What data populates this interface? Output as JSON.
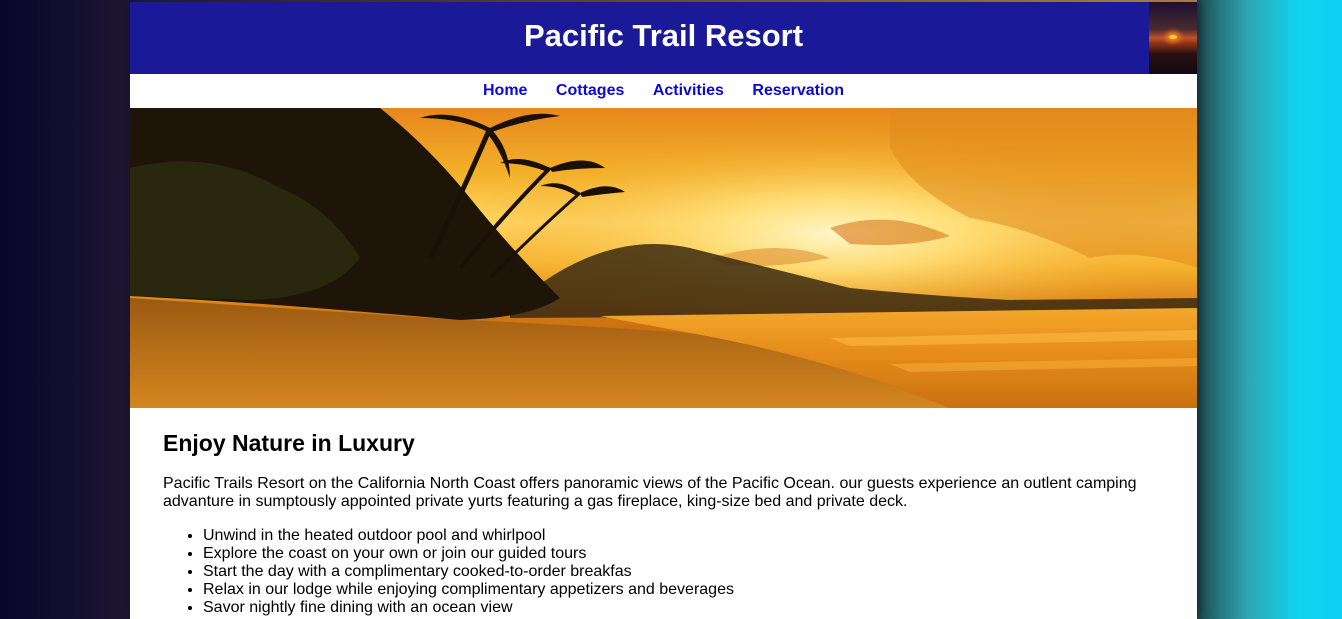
{
  "site": {
    "title": "Pacific Trail Resort"
  },
  "nav": {
    "items": [
      "Home",
      "Cottages",
      "Activities",
      "Reservation"
    ]
  },
  "main": {
    "heading": "Enjoy Nature in Luxury",
    "intro": "Pacific Trails Resort on the California North Coast offers panoramic views of the Pacific Ocean. our guests experience an outlent camping advanture in sumptously appointed private yurts featuring a gas fireplace, king-size bed and private deck.",
    "amenities": [
      "Unwind in the heated outdoor pool and whirlpool",
      "Explore the coast on your own or join our guided tours",
      "Start the day with a complimentary cooked-to-order breakfas",
      "Relax in our lodge while enjoying complimentary appetizers and beverages",
      "Savor nightly fine dining with an ocean view"
    ]
  },
  "colors": {
    "header_bg": "#1a1a99",
    "nav_link": "#0a0ad6",
    "page_bg_right": "#0fd3f0"
  },
  "images": {
    "header_thumb": "sunset-over-ocean-thumbnail",
    "hero": "tropical-beach-sunset-with-palm-trees"
  }
}
